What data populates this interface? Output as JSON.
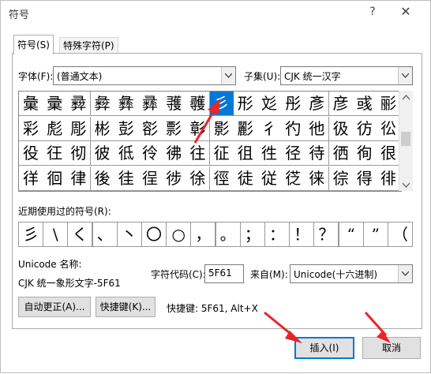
{
  "window": {
    "title": "符号",
    "help_icon": "question-icon",
    "close_icon": "close-icon"
  },
  "tabs": [
    {
      "label": "符号(S)"
    },
    {
      "label": "特殊字符(P)"
    }
  ],
  "font": {
    "label": "字体(F):",
    "value": "(普通文本)"
  },
  "subset": {
    "label": "子集(U):",
    "value": "CJK 统一汉字"
  },
  "grid": {
    "rows": [
      [
        "彙",
        "彚",
        "彛",
        "彜",
        "彝",
        "彞",
        "彟",
        "彠",
        "彡",
        "形",
        "彣",
        "彤",
        "彥",
        "彦",
        "彧",
        "彨"
      ],
      [
        "彩",
        "彪",
        "彫",
        "彬",
        "彭",
        "彮",
        "彯",
        "彰",
        "影",
        "彲",
        "彳",
        "彴",
        "彵",
        "彶",
        "彷",
        "彸"
      ],
      [
        "役",
        "彺",
        "彻",
        "彼",
        "彽",
        "彾",
        "彿",
        "往",
        "征",
        "徂",
        "徃",
        "径",
        "待",
        "徆",
        "徇",
        "很"
      ],
      [
        "徉",
        "徊",
        "律",
        "後",
        "徍",
        "徎",
        "徏",
        "徐",
        "徑",
        "徒",
        "従",
        "徔",
        "徕",
        "徖",
        "得",
        "徘"
      ]
    ],
    "selected": {
      "row": 0,
      "col": 8
    }
  },
  "recent": {
    "label": "近期使用过的符号(R):",
    "symbols": [
      "彡",
      "\\",
      "く",
      "、",
      "丶",
      "〇",
      "○",
      "，",
      "。",
      "；",
      "：",
      "！",
      "？",
      "“",
      "”",
      "（"
    ]
  },
  "unicode_name": {
    "label": "Unicode 名称:",
    "value": "CJK 统一象形文字-5F61"
  },
  "char_code": {
    "label": "字符代码(C):",
    "value": "5F61"
  },
  "from": {
    "label": "来自(M):",
    "value": "Unicode(十六进制)"
  },
  "buttons": {
    "autocorrect": "自动更正(A)...",
    "shortcut_key": "快捷键(K)...",
    "shortcut_text": "快捷键: 5F61, Alt+X",
    "insert": "插入(I)",
    "cancel": "取消"
  },
  "colors": {
    "selection": "#0078d7",
    "annotation_arrow": "#e8242c"
  }
}
